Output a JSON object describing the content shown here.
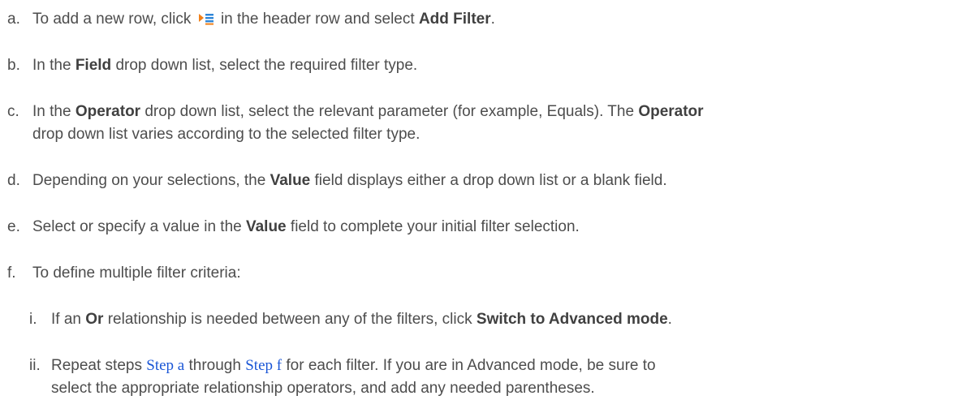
{
  "steps": [
    {
      "marker": "a.",
      "pre": "To add a new row, click",
      "icon": "add-row-menu-icon",
      "post": "in the header row and select",
      "bold": "Add Filter",
      "end": "."
    },
    {
      "marker": "b.",
      "pre": "In the",
      "bold": "Field",
      "post": "drop down list, select the required filter type."
    },
    {
      "marker": "c.",
      "line1_pre": "In the",
      "bold1": "Operator",
      "line1_mid": "drop down list, select the relevant parameter (for example, Equals). The",
      "bold2": "Operator",
      "line2": "drop down list varies according to the selected filter type."
    },
    {
      "marker": "d.",
      "pre": "Depending on your selections, the",
      "bold": "Value",
      "post": "field displays either a drop down list or a blank field."
    },
    {
      "marker": "e.",
      "pre": "Select or specify a value in the",
      "bold": "Value",
      "post": "field to complete your initial filter selection."
    },
    {
      "marker": "f.",
      "text": "To define multiple filter criteria:"
    }
  ],
  "substeps": [
    {
      "marker": "i.",
      "pre": "If an",
      "bold1": "Or",
      "mid": "relationship is needed between any of the filters, click",
      "bold2": "Switch to Advanced mode",
      "end": "."
    },
    {
      "marker": "ii.",
      "pre": "Repeat steps",
      "link1": "Step a",
      "mid": "through",
      "link2": "Step f",
      "post": "for each filter. If you are in Advanced mode, be sure to",
      "line2": "select the appropriate relationship operators, and add any needed parentheses."
    }
  ],
  "colors": {
    "text": "#4d4d4d",
    "link": "#1a56d6",
    "icon_orange": "#f0801a",
    "icon_blue": "#2e86d8"
  }
}
